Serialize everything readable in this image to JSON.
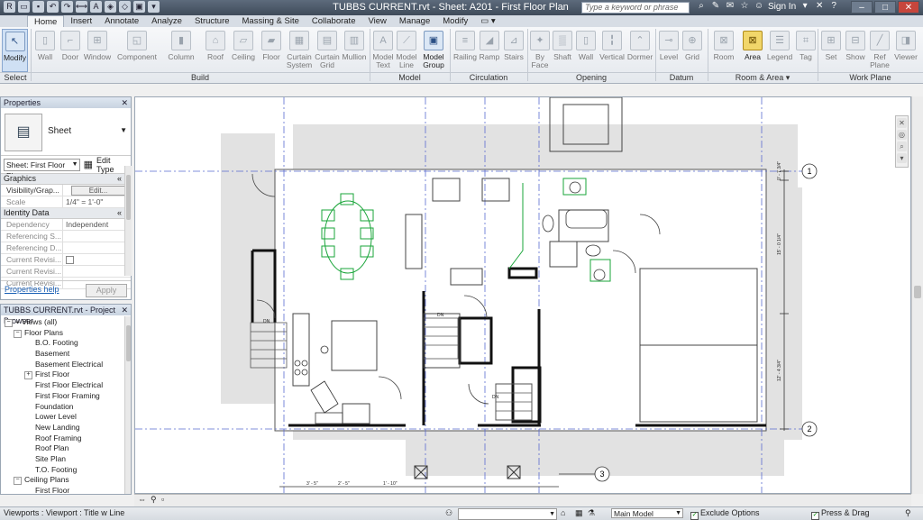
{
  "app": {
    "title": "TUBBS CURRENT.rvt - Sheet: A201 - First Floor Plan",
    "search_placeholder": "Type a keyword or phrase",
    "signin": "Sign In"
  },
  "tabs": [
    "Home",
    "Insert",
    "Annotate",
    "Analyze",
    "Structure",
    "Massing & Site",
    "Collaborate",
    "View",
    "Manage",
    "Modify"
  ],
  "ribbon": {
    "modify": "Modify",
    "select_panel": "Select",
    "build_panel": "Build",
    "model_panel": "Model",
    "circulation_panel": "Circulation",
    "opening_panel": "Opening",
    "datum_panel": "Datum",
    "room_area_panel": "Room & Area ▾",
    "work_plane_panel": "Work Plane",
    "tools": {
      "wall": "Wall",
      "door": "Door",
      "window": "Window",
      "component": "Component",
      "column": "Column",
      "roof": "Roof",
      "ceiling": "Ceiling",
      "floor": "Floor",
      "curtain_system": "Curtain System",
      "curtain_grid": "Curtain Grid",
      "mullion": "Mullion",
      "model_text": "Model Text",
      "model_line": "Model Line",
      "model_group": "Model Group",
      "railing": "Railing",
      "ramp": "Ramp",
      "stairs": "Stairs",
      "by_face": "By Face",
      "shaft": "Shaft",
      "wall_op": "Wall",
      "vertical": "Vertical",
      "dormer": "Dormer",
      "level": "Level",
      "grid": "Grid",
      "room": "Room",
      "area": "Area",
      "legend": "Legend",
      "tag": "Tag",
      "set": "Set",
      "show": "Show",
      "ref_plane": "Ref Plane",
      "viewer": "Viewer"
    }
  },
  "properties": {
    "title": "Properties",
    "type_name": "Sheet",
    "instance": "Sheet: First Floor Plar",
    "edit_type": "Edit Type",
    "groups": {
      "graphics": "Graphics",
      "identity": "Identity Data"
    },
    "rows": {
      "visibility_label": "Visibility/Grap...",
      "visibility_value": "Edit...",
      "scale_label": "Scale",
      "scale_value": "1/4\" = 1'-0\"",
      "dependency_label": "Dependency",
      "dependency_value": "Independent",
      "ref_s": "Referencing S...",
      "ref_d": "Referencing D...",
      "cur_rev1": "Current Revisi...",
      "cur_rev2": "Current Revisi...",
      "cur_rev3": "Current Revisi..."
    },
    "help": "Properties help",
    "apply": "Apply"
  },
  "browser": {
    "title": "TUBBS CURRENT.rvt - Project Browser",
    "views": "Views (all)",
    "floor_plans": "Floor Plans",
    "items": [
      "B.O. Footing",
      "Basement",
      "Basement Electrical",
      "First Floor",
      "First Floor Electrical",
      "First Floor Framing",
      "Foundation",
      "Lower Level",
      "New Landing",
      "Roof Framing",
      "Roof Plan",
      "Site Plan",
      "T.O. Footing"
    ],
    "ceiling_plans": "Ceiling Plans",
    "ceiling_items": [
      "First Floor"
    ]
  },
  "drawing": {
    "grid_labels": [
      "1",
      "2",
      "3"
    ],
    "dims_right": [
      "0' - 7 3/4\"",
      "15' - 0 1/4\"",
      "12' - 4 3/4\""
    ],
    "dims_bottom": [
      "3' - 5\"",
      "2' - 5\"",
      "1' - 10\""
    ],
    "tags": [
      "DN",
      "DN",
      "DN"
    ]
  },
  "status": {
    "text": "Viewports : Viewport : Title w Line",
    "model": "Main Model",
    "exclude": "Exclude Options",
    "press_drag": "Press & Drag"
  }
}
